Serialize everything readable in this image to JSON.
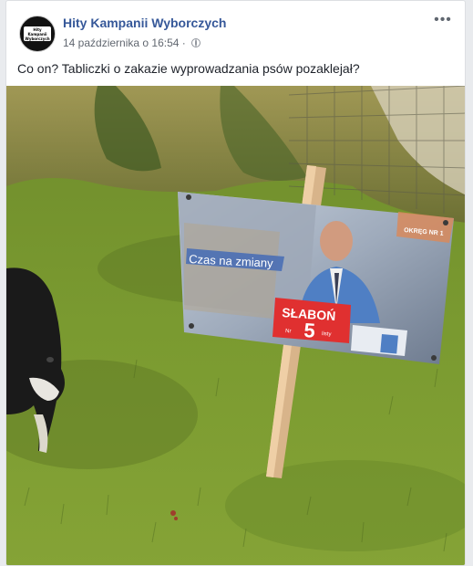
{
  "post": {
    "page_name": "Hity Kampanii Wyborczych",
    "timestamp": "14 października o 16:54",
    "separator": "·",
    "caption": "Co on? Tabliczki o zakazie wyprowadzania psów pozaklejał?",
    "more_glyph": "•••",
    "avatar_text": "Hity Kampanii Wyborczych",
    "privacy_icon": "globe-icon"
  },
  "photo": {
    "sign": {
      "slogan": "Czas na zmiany",
      "surname": "SŁABOŃ",
      "list_prefix": "Nr",
      "list_number": "5",
      "list_suffix": "listy",
      "district": "OKRĘG NR 1"
    }
  }
}
